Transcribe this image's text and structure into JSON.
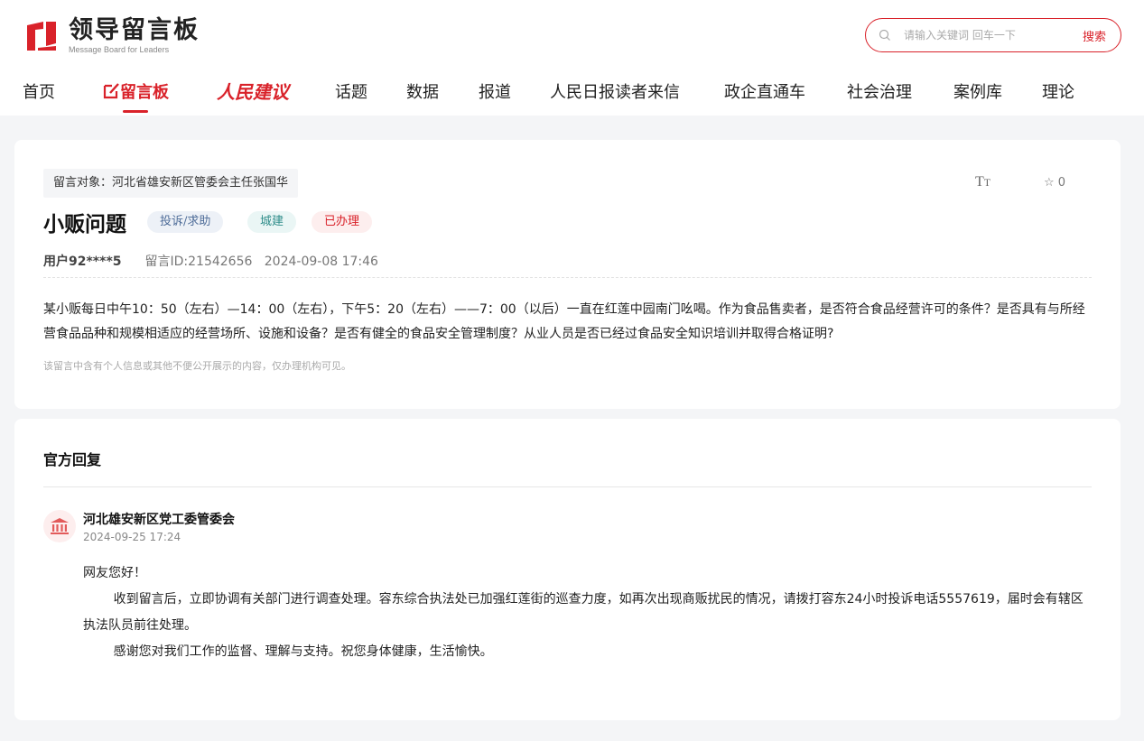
{
  "logo": {
    "title": "领导留言板",
    "subtitle": "Message Board for Leaders"
  },
  "search": {
    "placeholder": "请输入关键词 回车一下",
    "button": "搜索"
  },
  "nav": {
    "items": [
      "首页",
      "留言板",
      "人民建议",
      "话题",
      "数据",
      "报道",
      "人民日报读者来信",
      "政企直通车",
      "社会治理",
      "案例库",
      "理论"
    ],
    "active": "留言板"
  },
  "message": {
    "target": "留言对象：河北省雄安新区管委会主任张国华",
    "font_size_icon": "TT",
    "favorite_count": "0",
    "title": "小贩问题",
    "tags": [
      "投诉/求助",
      "城建",
      "已办理"
    ],
    "user": "用户92****5",
    "message_id": "留言ID:21542656",
    "time": "2024-09-08 17:46",
    "content": "某小贩每日中午10：50（左右）—14：00（左右），下午5：20（左右）——7：00（以后）一直在红莲中园南门吆喝。作为食品售卖者，是否符合食品经营许可的条件？是否具有与所经营食品品种和规模相适应的经营场所、设施和设备？是否有健全的食品安全管理制度？从业人员是否已经过食品安全知识培训并取得合格证明?",
    "note": "该留言中含有个人信息或其他不便公开展示的内容，仅办理机构可见。"
  },
  "reply": {
    "section_title": "官方回复",
    "org": "河北雄安新区党工委管委会",
    "time": "2024-09-25 17:24",
    "greeting": "网友您好！",
    "paragraph1": "收到留言后，立即协调有关部门进行调查处理。容东综合执法处已加强红莲街的巡查力度，如再次出现商贩扰民的情况，请拨打容东24小时投诉电话5557619，届时会有辖区执法队员前往处理。",
    "paragraph2": "感谢您对我们工作的监督、理解与支持。祝您身体健康，生活愉快。"
  },
  "colors": {
    "brand_red": "#d9222a",
    "page_bg": "#f4f5f7"
  }
}
